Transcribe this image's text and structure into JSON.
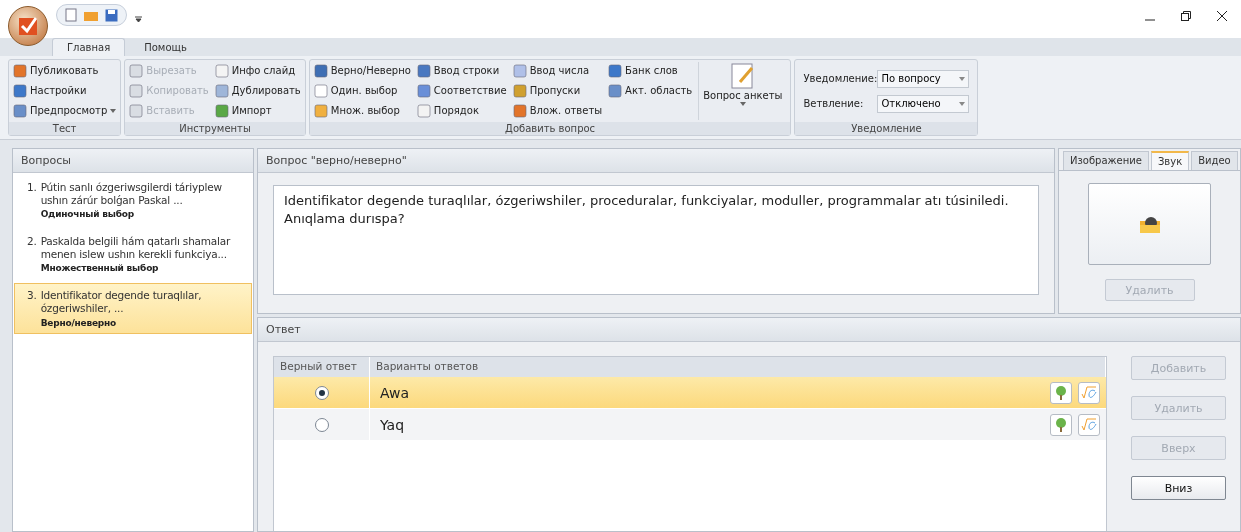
{
  "tabs": [
    {
      "label": "Главная",
      "selected": true
    },
    {
      "label": "Помощь",
      "selected": false
    }
  ],
  "ribbon": [
    {
      "title": "Тест",
      "columns": [
        [
          {
            "label": "Публиковать",
            "disabled": false
          },
          {
            "label": "Настройки",
            "disabled": false
          },
          {
            "label": "Предпросмотр",
            "disabled": false,
            "dropdown": true
          }
        ]
      ]
    },
    {
      "title": "Инструменты",
      "columns": [
        [
          {
            "label": "Вырезать",
            "disabled": true
          },
          {
            "label": "Копировать",
            "disabled": true
          },
          {
            "label": "Вставить",
            "disabled": true
          }
        ],
        [
          {
            "label": "Инфо слайд",
            "disabled": false
          },
          {
            "label": "Дублировать",
            "disabled": false
          },
          {
            "label": "Импорт",
            "disabled": false
          }
        ]
      ]
    },
    {
      "title": "Добавить вопрос",
      "columns": [
        [
          {
            "label": "Верно/Неверно",
            "disabled": false
          },
          {
            "label": "Один. выбор",
            "disabled": false
          },
          {
            "label": "Множ. выбор",
            "disabled": false
          }
        ],
        [
          {
            "label": "Ввод строки",
            "disabled": false
          },
          {
            "label": "Соответствие",
            "disabled": false
          },
          {
            "label": "Порядок",
            "disabled": false
          }
        ],
        [
          {
            "label": "Ввод числа",
            "disabled": false
          },
          {
            "label": "Пропуски",
            "disabled": false
          },
          {
            "label": "Влож. ответы",
            "disabled": false
          }
        ],
        [
          {
            "label": "Банк слов",
            "disabled": false
          },
          {
            "label": "Акт. область",
            "disabled": false
          }
        ]
      ],
      "big_button": {
        "label": "Вопрос анкеты",
        "dropdown": true
      }
    },
    {
      "title": "Уведомление",
      "fields": [
        {
          "label": "Уведомление:",
          "value": "По вопросу"
        },
        {
          "label": "Ветвление:",
          "value": "Отключено"
        }
      ]
    }
  ],
  "questions": {
    "title": "Вопросы",
    "items": [
      {
        "number": "1.",
        "text": "Pútin sanlı ózgeriwsgilerdi táriyplew ushın zárúr bolǵan Paskal ...",
        "type": "Одиночный выбор",
        "selected": false
      },
      {
        "number": "2.",
        "text": "Paskalda belgili hám qatarlı shamalar menen islew ushın kerekli funkciya...",
        "type": "Множественный выбор",
        "selected": false
      },
      {
        "number": "3.",
        "text": "Identifikator degende turaqlılar, ózgeriwshiler, ...",
        "type": "Верно/неверно",
        "selected": true
      }
    ]
  },
  "question": {
    "title": "Вопрос \"верно/неверно\"",
    "text": "Identifikator degende turaqlılar, ózgeriwshiler, proceduralar, funkciyalar, moduller, programmalar atı túsiniledi. Anıqlama durıspa?"
  },
  "media": {
    "tabs": [
      {
        "label": "Изображение",
        "selected": false
      },
      {
        "label": "Звук",
        "selected": true
      },
      {
        "label": "Видео",
        "selected": false
      }
    ],
    "delete_button": {
      "label": "Удалить",
      "disabled": true
    }
  },
  "answer": {
    "title": "Ответ",
    "columns": [
      "Верный ответ",
      "Варианты ответов"
    ],
    "rows": [
      {
        "correct": true,
        "text": "Awa",
        "selected": true
      },
      {
        "correct": false,
        "text": "Yaq",
        "selected": false
      }
    ],
    "buttons": [
      {
        "label": "Добавить",
        "disabled": true
      },
      {
        "label": "Удалить",
        "disabled": true
      },
      {
        "label": "Вверх",
        "disabled": true
      },
      {
        "label": "Вниз",
        "disabled": false
      }
    ]
  }
}
